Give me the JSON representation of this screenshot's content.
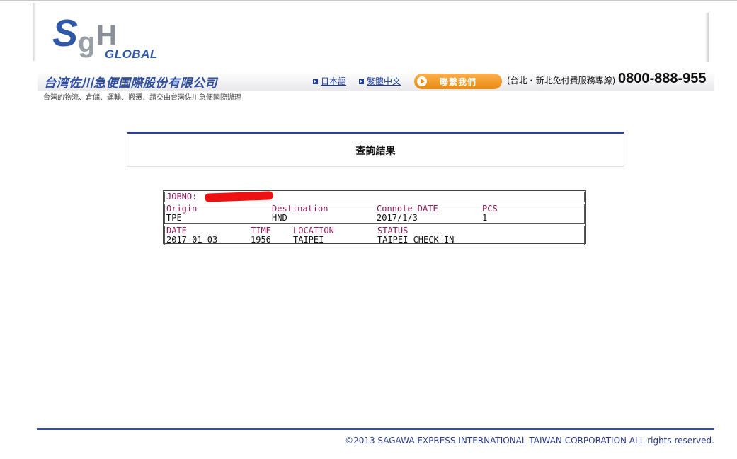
{
  "logo": {
    "s": "S",
    "g": "g",
    "h": "H",
    "global": "GLOBAL"
  },
  "header": {
    "company_name": "台湾佐川急便国際股份有限公司",
    "tagline": "台灣的物流、倉儲、運輸、搬遷．請交由台灣佐川急便國際辦理",
    "lang_japanese": "日本語",
    "lang_chinese": "繁體中文",
    "contact_button": "聯繫我們",
    "hotline_label": "(台北・新北免付費服務專線)",
    "hotline_number": "0800-888-955"
  },
  "result": {
    "title": "查詢結果",
    "jobno_label": "JOBNO:",
    "shipment": {
      "origin_label": "Origin",
      "origin": "TPE",
      "destination_label": "Destination",
      "destination": "HND",
      "connote_date_label": "Connote DATE",
      "connote_date": "2017/1/3",
      "pcs_label": "PCS",
      "pcs": "1"
    },
    "tracking": {
      "date_label": "DATE",
      "date": "2017-01-03",
      "time_label": "TIME",
      "time": "1956",
      "location_label": "LOCATION",
      "location": "TAIPEI",
      "status_label": "STATUS",
      "status": "TAIPEI CHECK IN"
    }
  },
  "footer": {
    "copyright": "©2013 SAGAWA EXPRESS INTERNATIONAL TAIWAN CORPORATION ALL rights reserved."
  },
  "colors": {
    "brand_blue": "#2f58a6",
    "button_orange": "#f29a22",
    "label_maroon": "#8a1a5a",
    "footer_rule": "#3b4ba3"
  }
}
